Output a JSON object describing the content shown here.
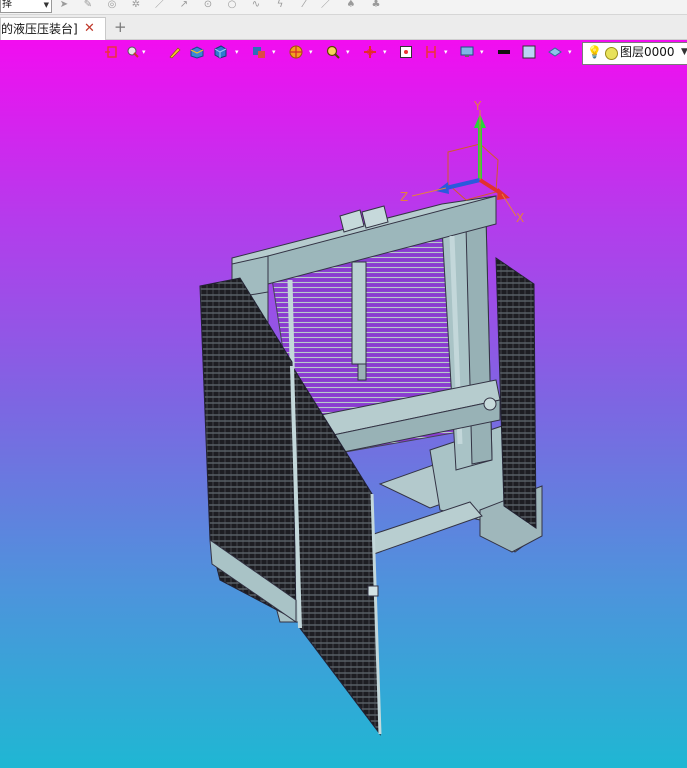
{
  "app": {
    "mode_select_value": "择",
    "document_tab_label": "的液压压装台]",
    "document_tab_close": "✕",
    "add_tab_label": "+"
  },
  "toolbar_icons": [
    {
      "name": "arrow-icon",
      "glyph": "➤"
    },
    {
      "name": "pencil-icon",
      "glyph": "✎"
    },
    {
      "name": "circle-play-icon",
      "glyph": "◎"
    },
    {
      "name": "line-icon",
      "glyph": "／"
    },
    {
      "name": "arrow-diagonal-icon",
      "glyph": "↗"
    },
    {
      "name": "circle-dot-icon",
      "glyph": "⊙"
    },
    {
      "name": "circle-icon",
      "glyph": "○"
    },
    {
      "name": "spline-icon",
      "glyph": "∿"
    },
    {
      "name": "curve-icon",
      "glyph": "ϟ"
    },
    {
      "name": "slash-icon",
      "glyph": "⁄"
    },
    {
      "name": "bird-icon",
      "glyph": "♠"
    },
    {
      "name": "bird-icon-2",
      "glyph": "♣"
    }
  ],
  "view_toolbar": {
    "layer_name": "图层0000",
    "colors": {
      "line_color": "#111111",
      "fill_color": "#bcd3f5",
      "bg_top": "#f20df0",
      "bg_bottom": "#1fb7d3",
      "model_color": "#a9c3c6"
    },
    "icons": [
      "view-rotate-icon",
      "select-filter-icon",
      "sketch-pencil-icon",
      "solid-box-icon",
      "cube-view-icon",
      "display-mode-icon",
      "section-icon",
      "zoom-icon",
      "origin-icon",
      "frame-icon",
      "measure-icon",
      "monitor-icon",
      "line-color-icon",
      "fill-color-icon",
      "layer-visibility-icon"
    ]
  },
  "axis_labels": {
    "x": "X",
    "y": "Y",
    "z": "Z"
  }
}
